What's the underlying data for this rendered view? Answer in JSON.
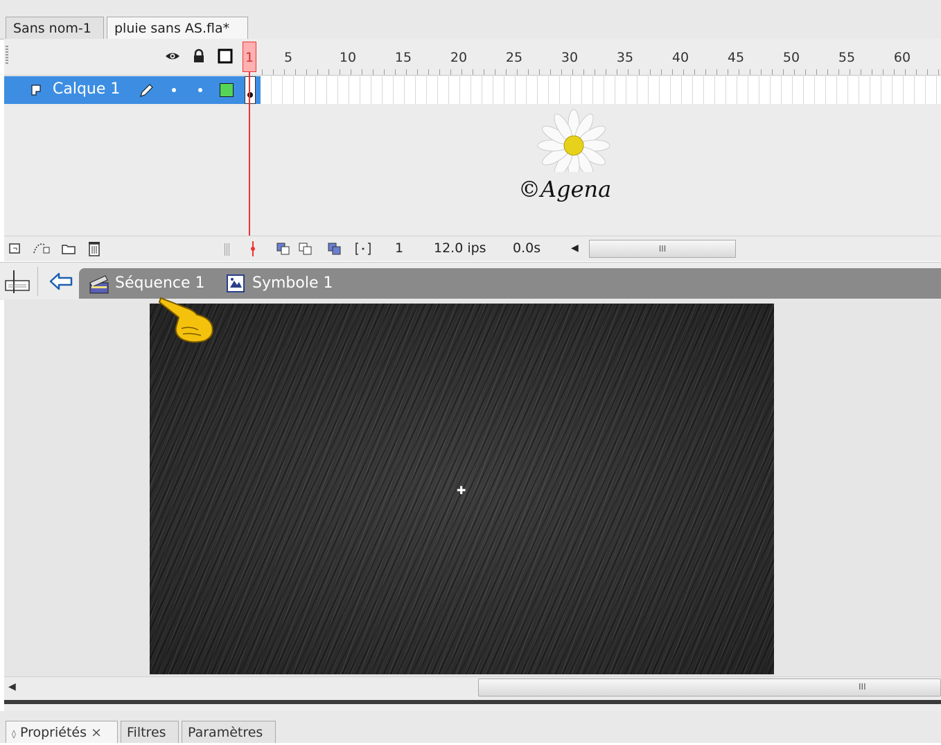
{
  "document_tabs": [
    {
      "label": "Sans nom-1",
      "active": false
    },
    {
      "label": "pluie sans AS.fla*",
      "active": true
    }
  ],
  "timeline": {
    "header_icons": [
      "eye-icon",
      "lock-icon",
      "outline-icon"
    ],
    "frame_numbers": [
      "1",
      "5",
      "10",
      "15",
      "20",
      "25",
      "30",
      "35",
      "40",
      "45",
      "50",
      "55",
      "60"
    ],
    "layer": {
      "name": "Calque 1",
      "color": "#55d555"
    },
    "footer": {
      "current_frame": "1",
      "frame_rate": "12.0 ips",
      "elapsed_time": "0.0s",
      "scroll_thumb_glyph": "III"
    }
  },
  "watermark": {
    "text": "©Agena"
  },
  "edit_bar": {
    "breadcrumbs": [
      {
        "label": "Séquence 1",
        "icon": "clapperboard-icon"
      },
      {
        "label": "Symbole 1",
        "icon": "symbol-icon"
      }
    ]
  },
  "stage": {
    "background_color": "#2d2d2d"
  },
  "stage_scroll": {
    "thumb_glyph": "III"
  },
  "panel_tabs": [
    {
      "label": "Propriétés",
      "active": true
    },
    {
      "label": "Filtres",
      "active": false
    },
    {
      "label": "Paramètres",
      "active": false
    }
  ],
  "colors": {
    "selection_blue": "#3d8ee2",
    "playhead_red": "#ee3333"
  }
}
